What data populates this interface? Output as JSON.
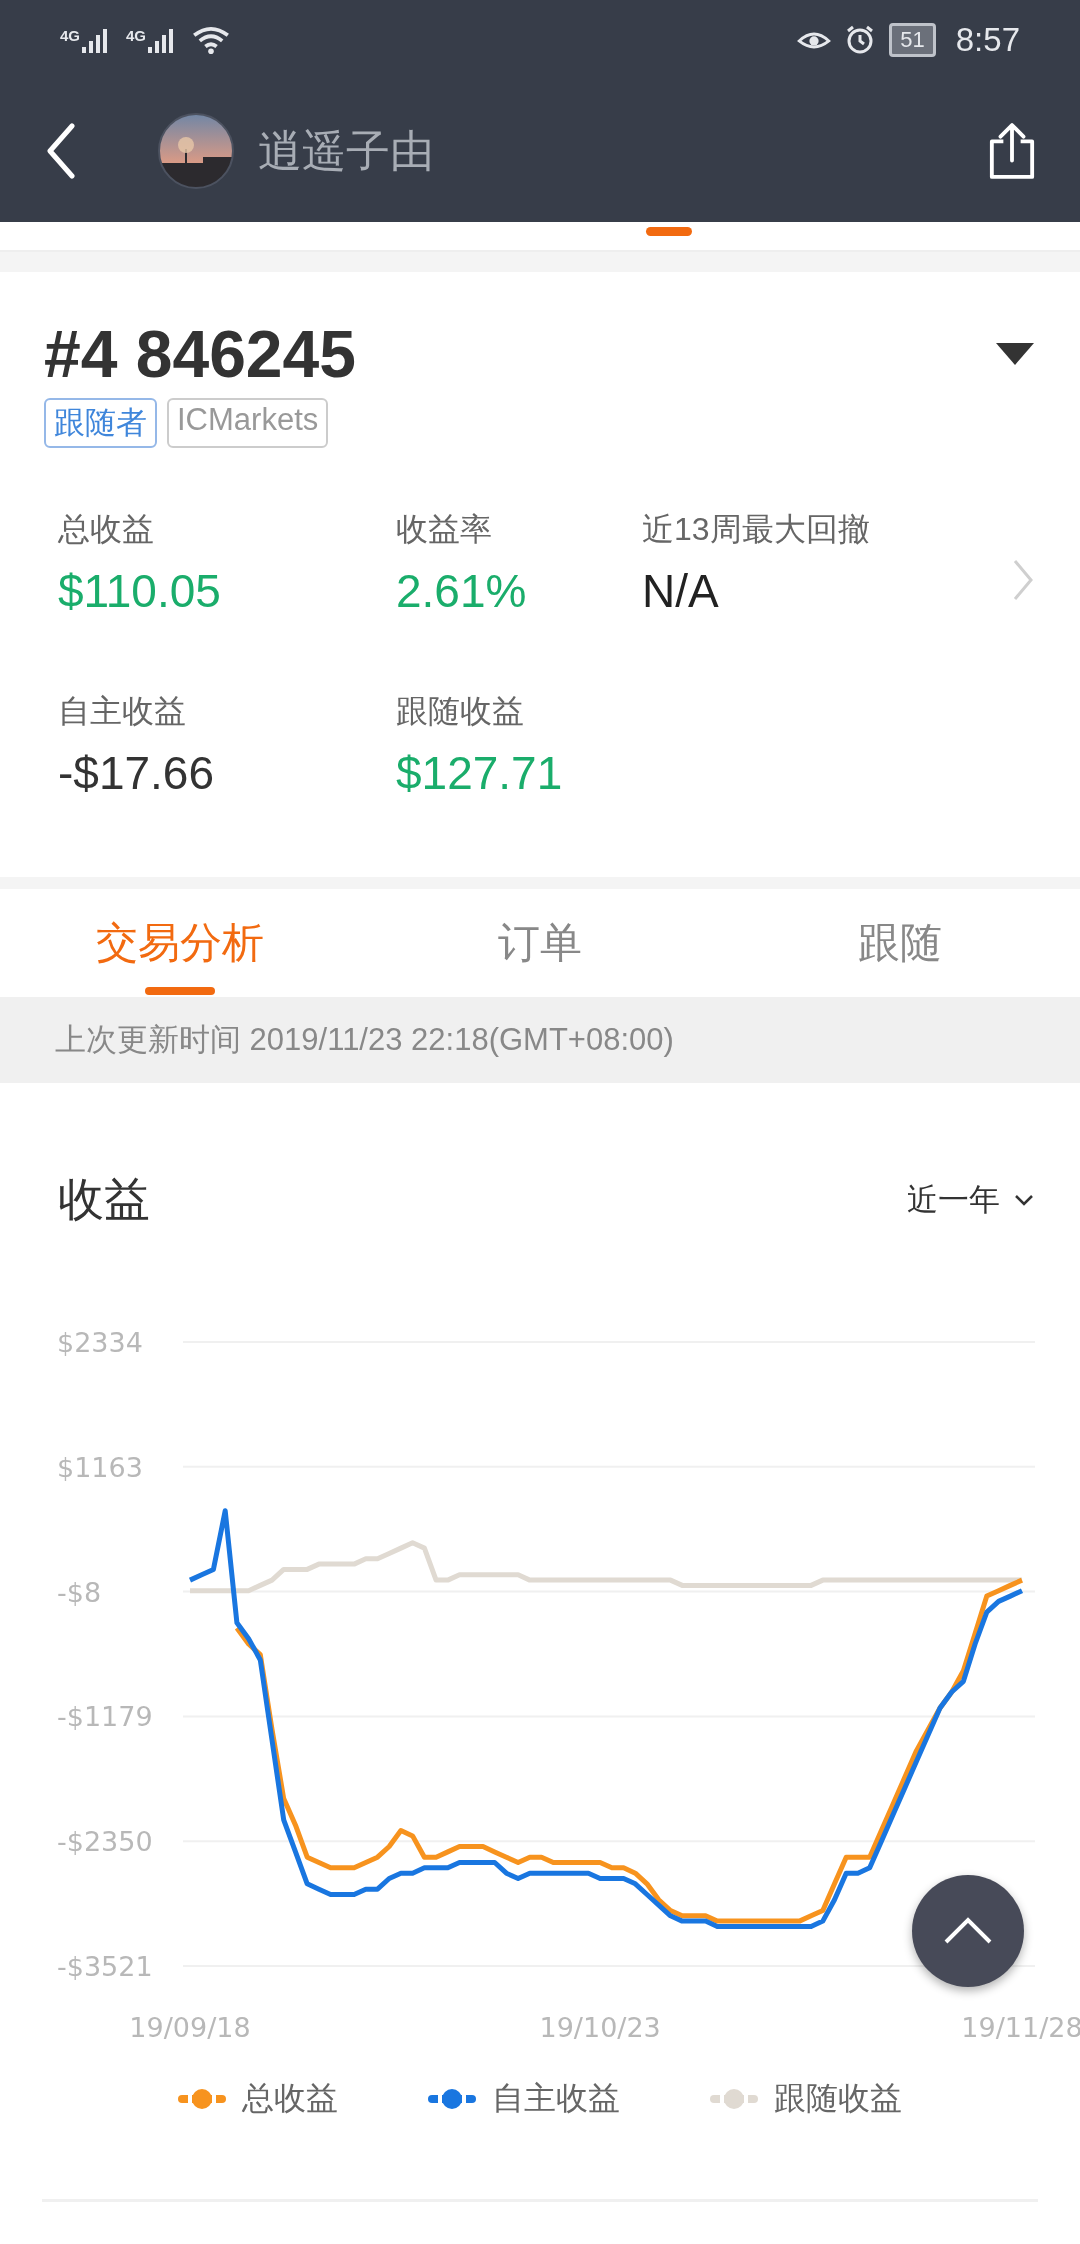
{
  "status_bar": {
    "network": [
      "4G",
      "4G"
    ],
    "battery": "51",
    "time": "8:57"
  },
  "header": {
    "name": "逍遥子由"
  },
  "account": {
    "title": "#4 846245",
    "tags": [
      {
        "label": "跟随者",
        "kind": "role"
      },
      {
        "label": "ICMarkets",
        "kind": "broker"
      }
    ]
  },
  "stats": [
    {
      "label": "总收益",
      "value": "$110.05",
      "color": "#1aad6b"
    },
    {
      "label": "收益率",
      "value": "2.61%",
      "color": "#1aad6b"
    },
    {
      "label": "近13周最大回撤",
      "value": "N/A",
      "color": "#222222"
    },
    {
      "label": "自主收益",
      "value": "-$17.66",
      "color": "#333333"
    },
    {
      "label": "跟随收益",
      "value": "$127.71",
      "color": "#1aad6b"
    }
  ],
  "tabs": [
    {
      "label": "交易分析",
      "selected": true
    },
    {
      "label": "订单",
      "selected": false
    },
    {
      "label": "跟随",
      "selected": false
    }
  ],
  "update_bar": {
    "text": "上次更新时间 2019/11/23 22:18(GMT+08:00)"
  },
  "chart_section": {
    "title": "收益",
    "range": "近一年",
    "chart_data": {
      "type": "line",
      "categories": [
        "19/09/18",
        null,
        null,
        null,
        null,
        null,
        null,
        null,
        null,
        null,
        null,
        null,
        null,
        null,
        null,
        null,
        null,
        null,
        null,
        null,
        null,
        null,
        null,
        null,
        null,
        null,
        null,
        null,
        null,
        null,
        null,
        null,
        null,
        null,
        null,
        "19/10/23",
        null,
        null,
        null,
        null,
        null,
        null,
        null,
        null,
        null,
        null,
        null,
        null,
        null,
        null,
        null,
        null,
        null,
        null,
        null,
        null,
        null,
        null,
        null,
        null,
        null,
        null,
        null,
        null,
        null,
        null,
        null,
        null,
        null,
        null,
        null,
        "19/11/28"
      ],
      "ylim": [
        -3521,
        2334
      ],
      "grid": true,
      "yticks": [
        {
          "value": 2334,
          "label": "$2334"
        },
        {
          "value": 1163,
          "label": "$1163"
        },
        {
          "value": -8,
          "label": "-$8"
        },
        {
          "value": -1179,
          "label": "-$1179"
        },
        {
          "value": -2350,
          "label": "-$2350"
        },
        {
          "value": -3521,
          "label": "-$3521"
        }
      ],
      "series": [
        {
          "name": "总收益",
          "color": "#f7931e",
          "values": [
            null,
            null,
            null,
            null,
            -350,
            -500,
            -600,
            -1300,
            -1950,
            -2200,
            -2500,
            -2550,
            -2600,
            -2600,
            -2600,
            -2550,
            -2500,
            -2400,
            -2250,
            -2300,
            -2500,
            -2500,
            -2450,
            -2400,
            -2400,
            -2400,
            -2450,
            -2500,
            -2550,
            -2500,
            -2500,
            -2550,
            -2550,
            -2550,
            -2550,
            -2550,
            -2600,
            -2600,
            -2650,
            -2750,
            -2900,
            -3000,
            -3050,
            -3050,
            -3050,
            -3100,
            -3100,
            -3100,
            -3100,
            -3100,
            -3100,
            -3100,
            -3100,
            -3050,
            -3000,
            -2750,
            -2500,
            -2500,
            -2500,
            -2250,
            -2000,
            -1750,
            -1500,
            -1300,
            -1100,
            -950,
            -750,
            -400,
            -50,
            0,
            50,
            100
          ]
        },
        {
          "name": "自主收益",
          "color": "#1976e0",
          "values": [
            100,
            150,
            200,
            750,
            -300,
            -450,
            -650,
            -1400,
            -2150,
            -2450,
            -2750,
            -2800,
            -2850,
            -2850,
            -2850,
            -2800,
            -2800,
            -2700,
            -2650,
            -2650,
            -2600,
            -2600,
            -2600,
            -2550,
            -2550,
            -2550,
            -2550,
            -2650,
            -2700,
            -2650,
            -2650,
            -2650,
            -2650,
            -2650,
            -2650,
            -2700,
            -2700,
            -2700,
            -2750,
            -2850,
            -2950,
            -3050,
            -3100,
            -3100,
            -3100,
            -3150,
            -3150,
            -3150,
            -3150,
            -3150,
            -3150,
            -3150,
            -3150,
            -3150,
            -3100,
            -2900,
            -2650,
            -2650,
            -2600,
            -2350,
            -2100,
            -1850,
            -1600,
            -1350,
            -1100,
            -950,
            -850,
            -500,
            -200,
            -100,
            -50,
            0
          ]
        },
        {
          "name": "跟随收益",
          "color": "#e0dad2",
          "values": [
            0,
            0,
            0,
            0,
            0,
            0,
            50,
            100,
            200,
            200,
            200,
            250,
            250,
            250,
            250,
            300,
            300,
            350,
            400,
            450,
            400,
            100,
            100,
            150,
            150,
            150,
            150,
            150,
            150,
            100,
            100,
            100,
            100,
            100,
            100,
            100,
            100,
            100,
            100,
            100,
            100,
            100,
            50,
            50,
            50,
            50,
            50,
            50,
            50,
            50,
            50,
            50,
            50,
            50,
            100,
            100,
            100,
            100,
            100,
            100,
            100,
            100,
            100,
            100,
            100,
            100,
            100,
            100,
            100,
            100,
            100,
            100
          ]
        }
      ]
    }
  }
}
